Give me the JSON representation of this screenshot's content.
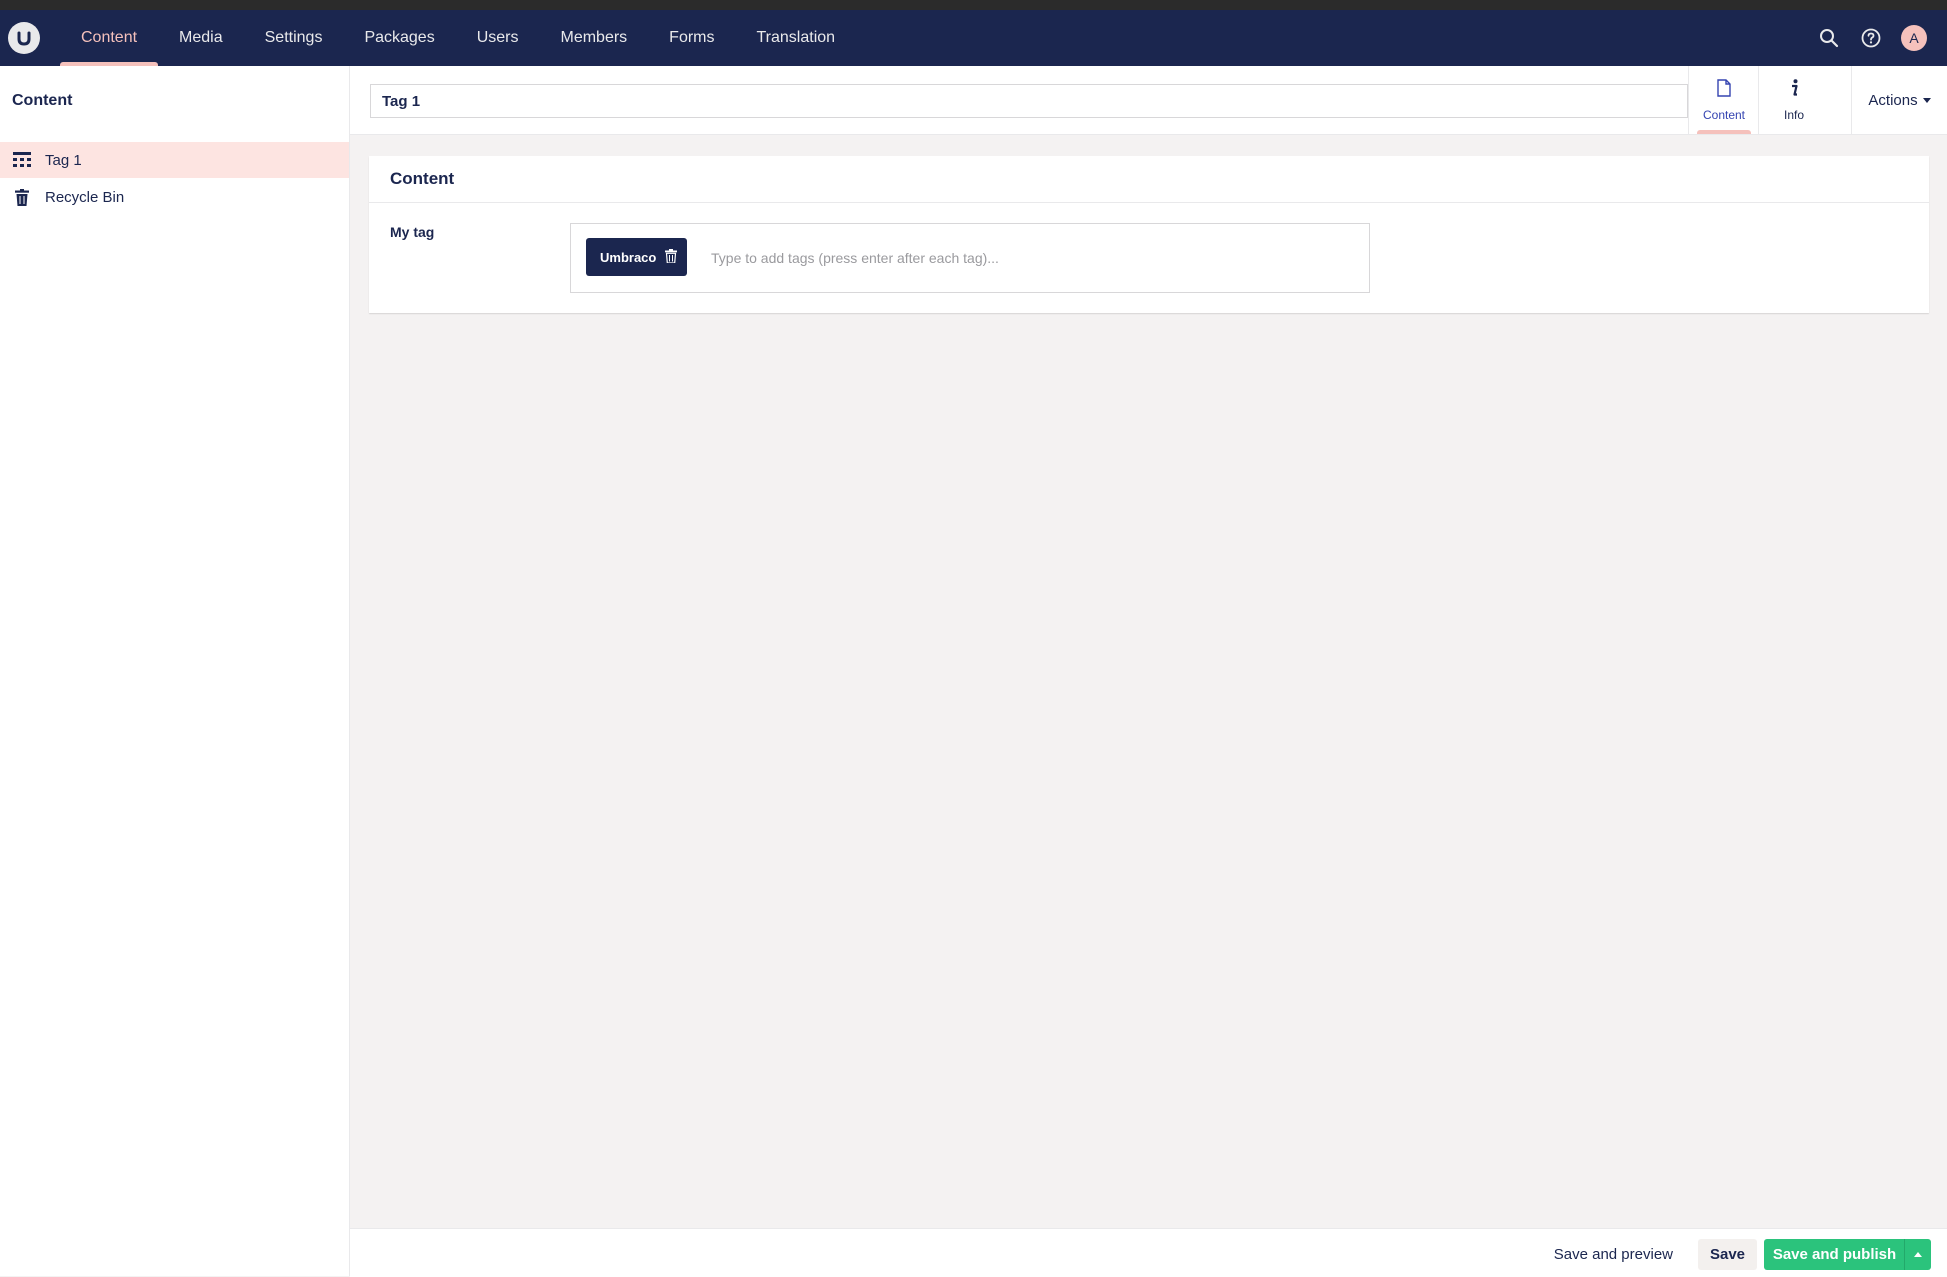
{
  "topbar": {
    "logo_icon": "umbraco-logo-icon",
    "sections": [
      "Content",
      "Media",
      "Settings",
      "Packages",
      "Users",
      "Members",
      "Forms",
      "Translation"
    ],
    "active_section": "Content",
    "icons": [
      "search-icon",
      "help-icon"
    ],
    "avatar_initial": "A"
  },
  "sidebar": {
    "title": "Content",
    "items": [
      {
        "label": "Tag 1",
        "icon": "grid-icon",
        "selected": true
      },
      {
        "label": "Recycle Bin",
        "icon": "trash-icon",
        "selected": false
      }
    ]
  },
  "editor": {
    "name_value": "Tag 1",
    "apps": [
      {
        "label": "Content",
        "icon": "document-icon",
        "active": true
      },
      {
        "label": "Info",
        "icon": "info-icon",
        "active": false
      }
    ],
    "actions_label": "Actions"
  },
  "panel": {
    "title": "Content",
    "property_label": "My tag",
    "tags": [
      "Umbraco"
    ],
    "tag_placeholder": "Type to add tags (press enter after each tag)..."
  },
  "footer": {
    "preview_label": "Save and preview",
    "save_label": "Save",
    "publish_label": "Save and publish"
  },
  "colors": {
    "header": "#1b264f",
    "accent": "#f5c1bc",
    "publish": "#2bc37c",
    "selected_bg": "#fde4e1"
  }
}
